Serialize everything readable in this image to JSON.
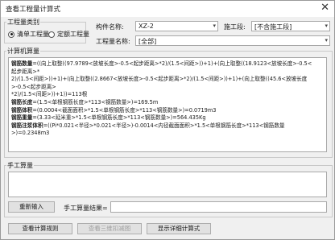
{
  "window": {
    "title": "查看工程量计算式",
    "close_glyph": "✕"
  },
  "quantity_type": {
    "legend": "工程量类别",
    "options": [
      {
        "label": "清单工程量",
        "selected": true
      },
      {
        "label": "定额工程量",
        "selected": false
      }
    ]
  },
  "filters": {
    "component_name_label": "构件名称:",
    "component_name_value": "XZ-2",
    "floor_section_label": "施工段:",
    "floor_section_value": "[不含施工段]",
    "quantity_name_label": "工程量名称:",
    "quantity_name_value": "[全部]"
  },
  "calc": {
    "legend": "计算机算量",
    "lines": [
      {
        "label": "钢筋数量",
        "text": "=((向上取整((97.9789<放坡长度>-0.5<起步距离>*2)/(1.5<间距>))+1)+(向上取整((18.9123<放坡长度>-0.5<起步距离>*"
      },
      {
        "label": "",
        "text": "2)/(1.5<间距>))+1)+(向上取整((2.8667<放坡长度>-0.5<起步距离>*2)/(1.5<间距>))+1)+(向上取整((45.6<放坡长度>-0.5<起步距离>"
      },
      {
        "label": "",
        "text": "*2)/(1.5<间距>))+1))=113根"
      },
      {
        "label": "钢筋长度",
        "text": "=(1.5<单根钢筋长度>*113<钢筋数量>)=169.5m"
      },
      {
        "label": "钢筋体积",
        "text": "=(0.0004<截面面积>*1.5<单根钢筋长度>*113<钢筋数量>)=0.0719m3"
      },
      {
        "label": "钢筋重量",
        "text": "=(3.33<延米重>*1.5<单根钢筋长度>*113<钢筋数量>)=564.435Kg"
      },
      {
        "label": "钢筋注浆体积",
        "text": "=((Pi*0.021<半径>*0.021<半径>)-0.0014<内径截面面积>*1.5<单根钢筋长度>*113<钢筋数量>)=0.2348m3"
      }
    ]
  },
  "manual": {
    "legend": "手工算量",
    "re_enter_button": "重新输入",
    "result_label": "手工算量结果=",
    "result_value": ""
  },
  "footer": {
    "view_rules_button": "查看计算规则",
    "view_3d_button": "查看三维扣减图",
    "show_detail_button": "显示详细计算式"
  }
}
